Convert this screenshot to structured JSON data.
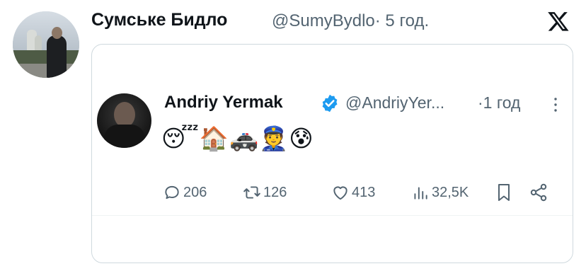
{
  "header": {
    "display_name": "Сумське Бидло",
    "handle": "@SumyBydlo",
    "separator": "·",
    "time": "5 год."
  },
  "quoted_tweet": {
    "display_name": "Andriy Yermak",
    "handle": "@AndriyYer...",
    "separator": "·",
    "time": "1 год",
    "emoji_text": "😴🏠🚓👮😰",
    "stats": {
      "replies": "206",
      "retweets": "126",
      "likes": "413",
      "views": "32,5K"
    }
  },
  "icons": {
    "brand": "x-logo-icon",
    "verified": "verified-badge-icon",
    "more": "more-vertical-icon",
    "reply": "reply-icon",
    "retweet": "retweet-icon",
    "like": "heart-icon",
    "views": "views-icon",
    "bookmark": "bookmark-icon",
    "share": "share-icon"
  },
  "colors": {
    "text": "#0f1419",
    "secondary": "#536471",
    "verified": "#1d9bf0",
    "border": "#cfd9de"
  }
}
